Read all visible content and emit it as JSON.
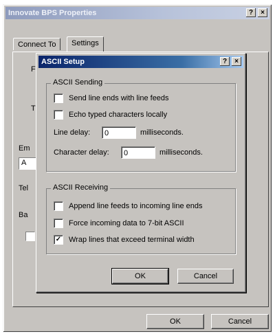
{
  "properties_window": {
    "title": "Innovate BPS Properties",
    "help_btn": "?",
    "close_btn": "×",
    "tabs": [
      {
        "label": "Connect To"
      },
      {
        "label": "Settings"
      }
    ],
    "partial_labels": {
      "f": "F",
      "t": "T",
      "em": "Em",
      "tel": "Tel",
      "ba": "Ba",
      "a": "A"
    },
    "ok_label": "OK",
    "cancel_label": "Cancel"
  },
  "ascii_setup": {
    "title": "ASCII Setup",
    "help_btn": "?",
    "close_btn": "×",
    "sending": {
      "legend": "ASCII Sending",
      "send_line_ends": {
        "label": "Send line ends with line feeds",
        "checked": false
      },
      "echo_typed": {
        "label": "Echo typed characters locally",
        "checked": false
      },
      "line_delay": {
        "label": "Line delay:",
        "value": "0",
        "unit": "milliseconds."
      },
      "char_delay": {
        "label": "Character delay:",
        "value": "0",
        "unit": "milliseconds."
      }
    },
    "receiving": {
      "legend": "ASCII Receiving",
      "append_line_feeds": {
        "label": "Append line feeds to incoming line ends",
        "checked": false
      },
      "force_7bit": {
        "label": "Force incoming data to 7-bit ASCII",
        "checked": false
      },
      "wrap_lines": {
        "label": "Wrap lines that exceed terminal width",
        "checked": true
      }
    },
    "ok_label": "OK",
    "cancel_label": "Cancel",
    "check_mark": "✓"
  }
}
